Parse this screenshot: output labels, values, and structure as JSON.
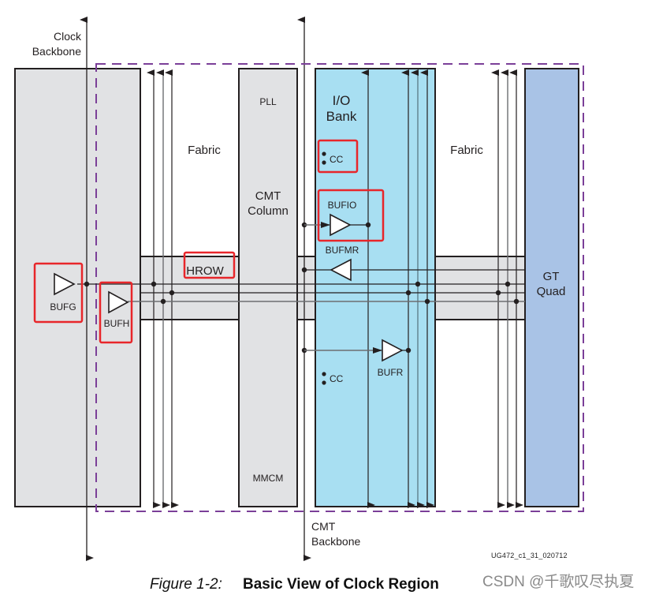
{
  "diagram": {
    "title": "Basic View of Clock Region",
    "figure_number": "Figure 1-2:",
    "figure_id": "UG472_c1_31_020712",
    "watermark": "CSDN @千歌叹尽执夏",
    "labels": {
      "clock_backbone": [
        "Clock",
        "Backbone"
      ],
      "cmt_backbone": [
        "CMT",
        "Backbone"
      ],
      "fabric_left": "Fabric",
      "fabric_right": "Fabric",
      "pll": "PLL",
      "cmt_column": [
        "CMT",
        "Column"
      ],
      "mmcm": "MMCM",
      "io_bank": [
        "I/O",
        "Bank"
      ],
      "cc_top": "CC",
      "cc_bottom": "CC",
      "bufio": "BUFIO",
      "bufmr": "BUFMR",
      "bufr": "BUFR",
      "bufg": "BUFG",
      "bufh": "BUFH",
      "hrow": "HROW",
      "gt_quad": [
        "GT",
        "Quad"
      ]
    },
    "highlighted": [
      "BUFG",
      "BUFH",
      "HROW",
      "CC",
      "BUFIO"
    ],
    "colors": {
      "gray_block": "#e1e2e4",
      "io_bank": "#a8dff2",
      "gt_quad": "#a9c3e6",
      "region_border": "#7b3f98",
      "highlight": "#e8262a",
      "line": "#231f20",
      "line_gray": "#6d6e71"
    }
  }
}
